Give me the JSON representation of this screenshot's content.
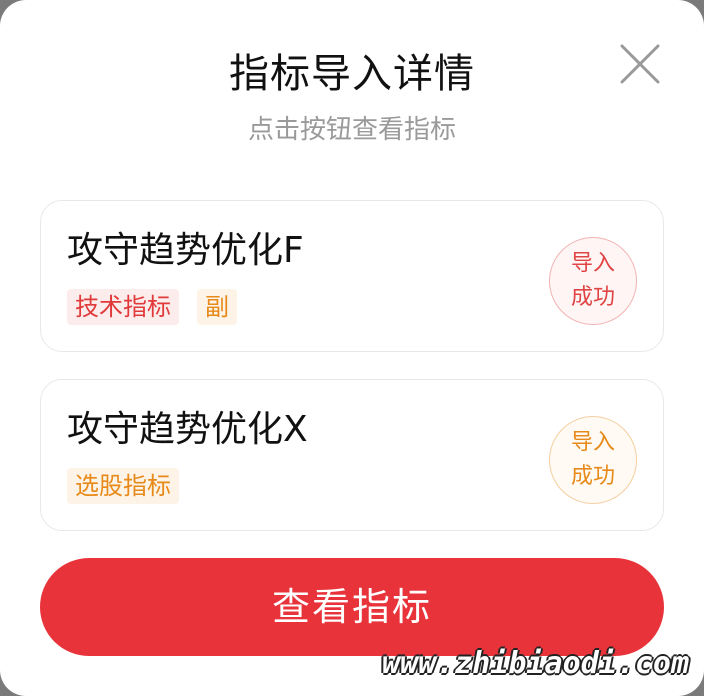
{
  "dialog": {
    "title": "指标导入详情",
    "subtitle": "点击按钮查看指标"
  },
  "indicators": [
    {
      "name": "攻守趋势优化F",
      "tags": [
        "技术指标",
        "副"
      ],
      "status_line1": "导入",
      "status_line2": "成功"
    },
    {
      "name": "攻守趋势优化X",
      "tags": [
        "选股指标"
      ],
      "status_line1": "导入",
      "status_line2": "成功"
    }
  ],
  "primary_button": {
    "label": "查看指标"
  },
  "watermark": "www.zhibiaodi.com",
  "colors": {
    "primary": "#e8333a",
    "tag_red": "#e03a3a",
    "tag_orange": "#e88a1a"
  },
  "icons": {
    "close": "close-icon"
  }
}
